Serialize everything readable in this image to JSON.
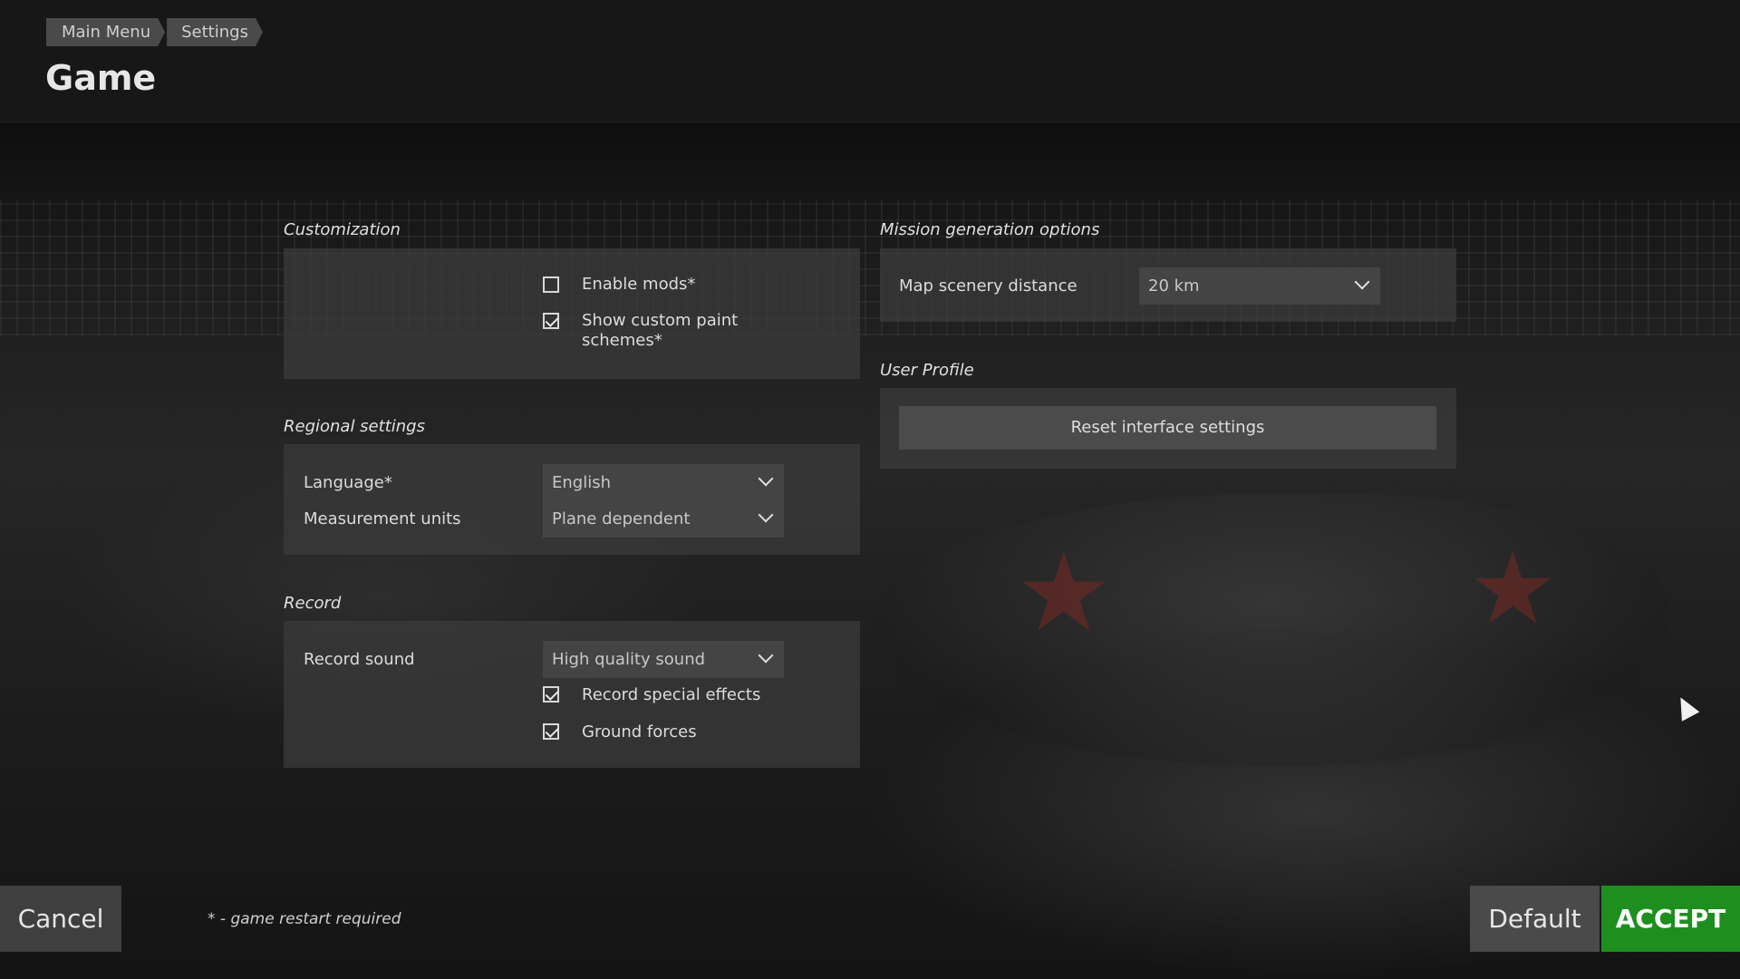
{
  "breadcrumb": {
    "items": [
      "Main Menu",
      "Settings"
    ]
  },
  "page": {
    "title": "Game"
  },
  "customization": {
    "title": "Customization",
    "enable_mods": {
      "label": "Enable mods*",
      "checked": false
    },
    "show_custom_paint": {
      "label": "Show custom paint schemes*",
      "checked": true
    }
  },
  "regional": {
    "title": "Regional settings",
    "language": {
      "label": "Language*",
      "value": "English"
    },
    "measurement": {
      "label": "Measurement units",
      "value": "Plane dependent"
    }
  },
  "record": {
    "title": "Record",
    "sound": {
      "label": "Record sound",
      "value": "High quality sound"
    },
    "special_effects": {
      "label": "Record special effects",
      "checked": true
    },
    "ground_forces": {
      "label": "Ground forces",
      "checked": true
    }
  },
  "mission": {
    "title": "Mission generation options",
    "map_distance": {
      "label": "Map scenery distance",
      "value": "20 km"
    }
  },
  "user_profile": {
    "title": "User Profile",
    "reset_label": "Reset interface settings"
  },
  "footer": {
    "note": "* - game restart required",
    "cancel": "Cancel",
    "default": "Default",
    "accept": "ACCEPT"
  },
  "colors": {
    "accept_green": "#1e8f1e",
    "panel_bg": "#3a3a3a"
  }
}
